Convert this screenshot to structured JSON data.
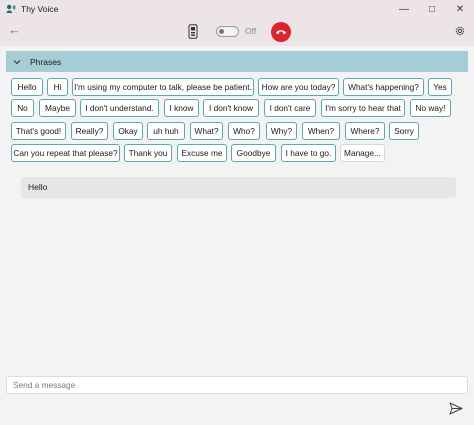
{
  "window": {
    "title": "Thy Voice",
    "minimize": "—",
    "maximize": "□",
    "close": "✕"
  },
  "toolbar": {
    "back_icon": "arrow-left-icon",
    "phone_icon": "phone-icon",
    "toggle_label": "Off",
    "toggle_on": false,
    "hangup_color": "#d9252b",
    "settings_icon": "gear-icon"
  },
  "phrases": {
    "header": "Phrases",
    "expanded": true,
    "items": [
      "Hello",
      "Hi",
      "I'm using my computer to talk, please be patient.",
      "How are you today?",
      "What's happening?",
      "Yes",
      "No",
      "Maybe",
      "I don't understand.",
      "I know",
      "I don't know",
      "I don't care",
      "I'm sorry to hear that",
      "No way!",
      "That's good!",
      "Really?",
      "Okay",
      "uh huh",
      "What?",
      "Who?",
      "Why?",
      "When?",
      "Where?",
      "Sorry",
      "Can you repeat that please?",
      "Thank you",
      "Excuse me",
      "Goodbye",
      "I have to go.",
      "Manage..."
    ]
  },
  "messages": [
    {
      "text": "Hello"
    }
  ],
  "composer": {
    "placeholder": "Send a message",
    "send_icon": "send-icon"
  },
  "colors": {
    "accent": "#a6cdd6",
    "chip_border": "#5aa8b2",
    "titlebar": "#ece4e7"
  }
}
